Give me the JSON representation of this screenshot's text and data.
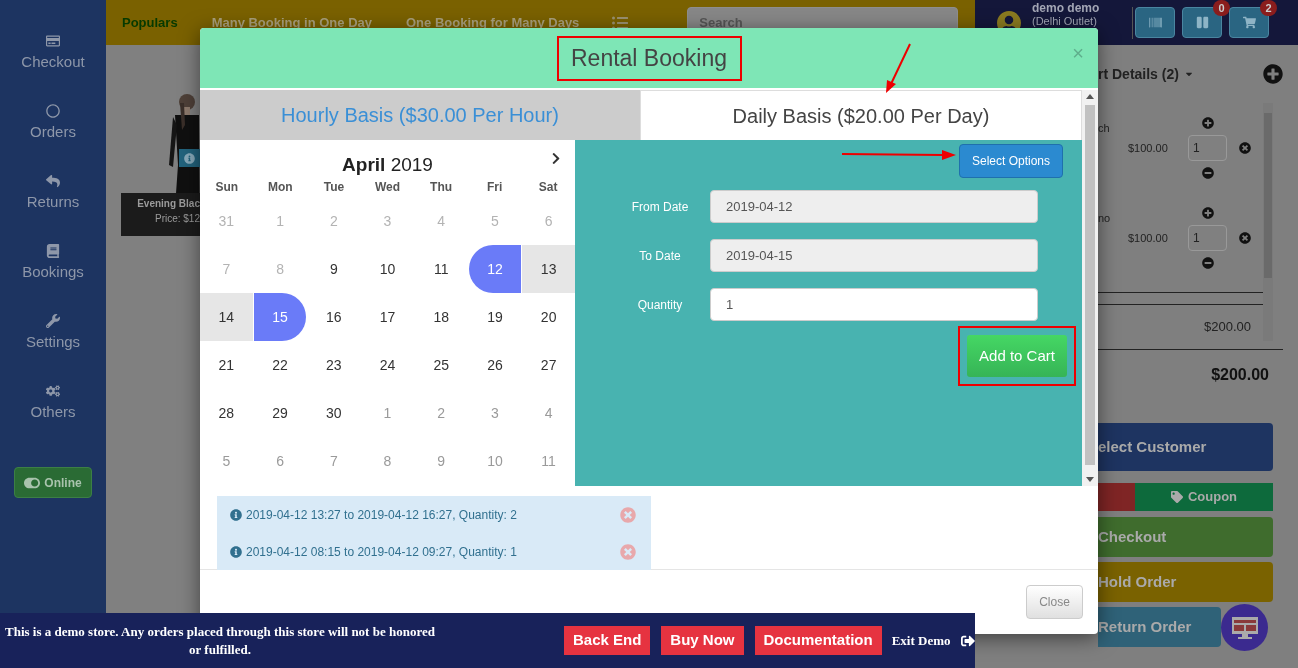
{
  "sidebar": {
    "items": [
      {
        "label": "Checkout",
        "kind": "card"
      },
      {
        "label": "Orders",
        "kind": "circle"
      },
      {
        "label": "Returns",
        "kind": "reply"
      },
      {
        "label": "Bookings",
        "kind": "book"
      },
      {
        "label": "Settings",
        "kind": "wrench"
      },
      {
        "label": "Others",
        "kind": "gears"
      }
    ],
    "online_toggle": {
      "label": "Online",
      "on": true
    }
  },
  "top_tabs": [
    {
      "label": "Populars",
      "selected": true
    },
    {
      "label": "Many Booking in One Day",
      "selected": false
    },
    {
      "label": "One Booking for Many Days",
      "selected": false
    }
  ],
  "search": {
    "placeholder": "Search"
  },
  "user": {
    "name": "demo demo",
    "outlet": "(Delhi Outlet)"
  },
  "header_buttons": [
    {
      "kind": "barcode"
    },
    {
      "kind": "pause",
      "badge": "0"
    },
    {
      "kind": "cart",
      "badge": "2"
    }
  ],
  "product": {
    "name": "Evening Blac",
    "price": "Price: $12"
  },
  "cart": {
    "title": "rt Details (2)",
    "items": [
      {
        "name": "ch",
        "price": "$100.00",
        "qty": "1"
      },
      {
        "name": "no",
        "price": "$100.00",
        "qty": "1"
      }
    ],
    "subtotal": "$200.00",
    "total": "$200.00",
    "actions": [
      {
        "label": "elect Customer",
        "kind": "customer"
      },
      {
        "kind": "discount"
      },
      {
        "label": "Coupon",
        "kind": "coupon"
      },
      {
        "label": "Checkout",
        "kind": "checkout"
      },
      {
        "label": "Hold Order",
        "kind": "hold"
      },
      {
        "label": "Return Order",
        "kind": "return"
      }
    ]
  },
  "modal": {
    "title": "Rental Booking",
    "close_symbol": "×",
    "tabs": [
      {
        "label": "Hourly Basis ($30.00 Per Hour)",
        "selected": false
      },
      {
        "label": "Daily Basis ($20.00 Per Day)",
        "selected": true
      }
    ],
    "calendar": {
      "month": "April",
      "year": "2019",
      "weekdays": [
        "Sun",
        "Mon",
        "Tue",
        "Wed",
        "Thu",
        "Fri",
        "Sat"
      ],
      "weeks": [
        [
          {
            "d": "31",
            "kind": "other"
          },
          {
            "d": "1",
            "kind": "other"
          },
          {
            "d": "2",
            "kind": "other"
          },
          {
            "d": "3",
            "kind": "other"
          },
          {
            "d": "4",
            "kind": "other"
          },
          {
            "d": "5",
            "kind": "other"
          },
          {
            "d": "6",
            "kind": "other"
          }
        ],
        [
          {
            "d": "7",
            "kind": "other"
          },
          {
            "d": "8",
            "kind": "other"
          },
          {
            "d": "9",
            "kind": "day"
          },
          {
            "d": "10",
            "kind": "day"
          },
          {
            "d": "11",
            "kind": "day"
          },
          {
            "d": "12",
            "kind": "start"
          },
          {
            "d": "13",
            "kind": "range"
          }
        ],
        [
          {
            "d": "14",
            "kind": "range"
          },
          {
            "d": "15",
            "kind": "end"
          },
          {
            "d": "16",
            "kind": "day"
          },
          {
            "d": "17",
            "kind": "day"
          },
          {
            "d": "18",
            "kind": "day"
          },
          {
            "d": "19",
            "kind": "day"
          },
          {
            "d": "20",
            "kind": "day"
          }
        ],
        [
          {
            "d": "21",
            "kind": "day"
          },
          {
            "d": "22",
            "kind": "day"
          },
          {
            "d": "23",
            "kind": "day"
          },
          {
            "d": "24",
            "kind": "day"
          },
          {
            "d": "25",
            "kind": "day"
          },
          {
            "d": "26",
            "kind": "day"
          },
          {
            "d": "27",
            "kind": "day"
          }
        ],
        [
          {
            "d": "28",
            "kind": "day"
          },
          {
            "d": "29",
            "kind": "day"
          },
          {
            "d": "30",
            "kind": "day"
          },
          {
            "d": "1",
            "kind": "muted"
          },
          {
            "d": "2",
            "kind": "muted"
          },
          {
            "d": "3",
            "kind": "muted"
          },
          {
            "d": "4",
            "kind": "muted"
          }
        ],
        [
          {
            "d": "5",
            "kind": "muted"
          },
          {
            "d": "6",
            "kind": "muted"
          },
          {
            "d": "7",
            "kind": "muted"
          },
          {
            "d": "8",
            "kind": "muted"
          },
          {
            "d": "9",
            "kind": "muted"
          },
          {
            "d": "10",
            "kind": "muted"
          },
          {
            "d": "11",
            "kind": "muted"
          }
        ]
      ]
    },
    "select_options": "Select Options",
    "fields": [
      {
        "label": "From Date",
        "value": "2019-04-12",
        "readonly": true
      },
      {
        "label": "To Date",
        "value": "2019-04-15",
        "readonly": true
      },
      {
        "label": "Quantity",
        "value": "1",
        "readonly": false
      }
    ],
    "add_to_cart": "Add to Cart",
    "bookings": [
      "2019-04-12 13:27 to 2019-04-12 16:27, Quantity: 2",
      "2019-04-12 08:15 to 2019-04-12 09:27, Quantity: 1"
    ],
    "close_button": "Close"
  },
  "demo_banner": {
    "message": "This is a demo store. Any orders placed through this store will not be honored or fulfilled.",
    "links": [
      "Back End",
      "Buy Now",
      "Documentation"
    ],
    "exit": "Exit Demo"
  }
}
